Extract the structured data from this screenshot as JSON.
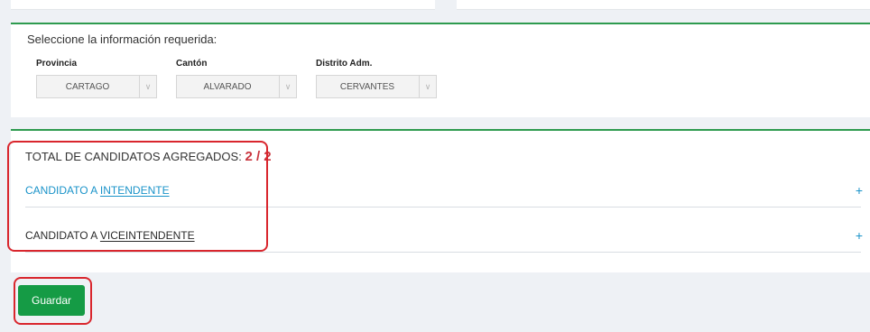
{
  "selector": {
    "title": "Seleccione la información requerida:",
    "fields": [
      {
        "label": "Provincia",
        "value": "CARTAGO"
      },
      {
        "label": "Cantón",
        "value": "ALVARADO"
      },
      {
        "label": "Distrito Adm.",
        "value": "CERVANTES"
      }
    ]
  },
  "candidates": {
    "total_label": "TOTAL DE CANDIDATOS AGREGADOS:",
    "total_count": "2 / 2",
    "items": [
      {
        "prefix": "CANDIDATO A ",
        "role": "INTENDENTE",
        "action": "+"
      },
      {
        "prefix": "CANDIDATO A ",
        "role": "VICEINTENDENTE",
        "action": "+"
      }
    ]
  },
  "actions": {
    "save_label": "Guardar"
  },
  "colors": {
    "accent": "#2e9b4f",
    "primary_button": "#159b45",
    "link": "#1a93c9",
    "highlight": "#d9262d"
  }
}
